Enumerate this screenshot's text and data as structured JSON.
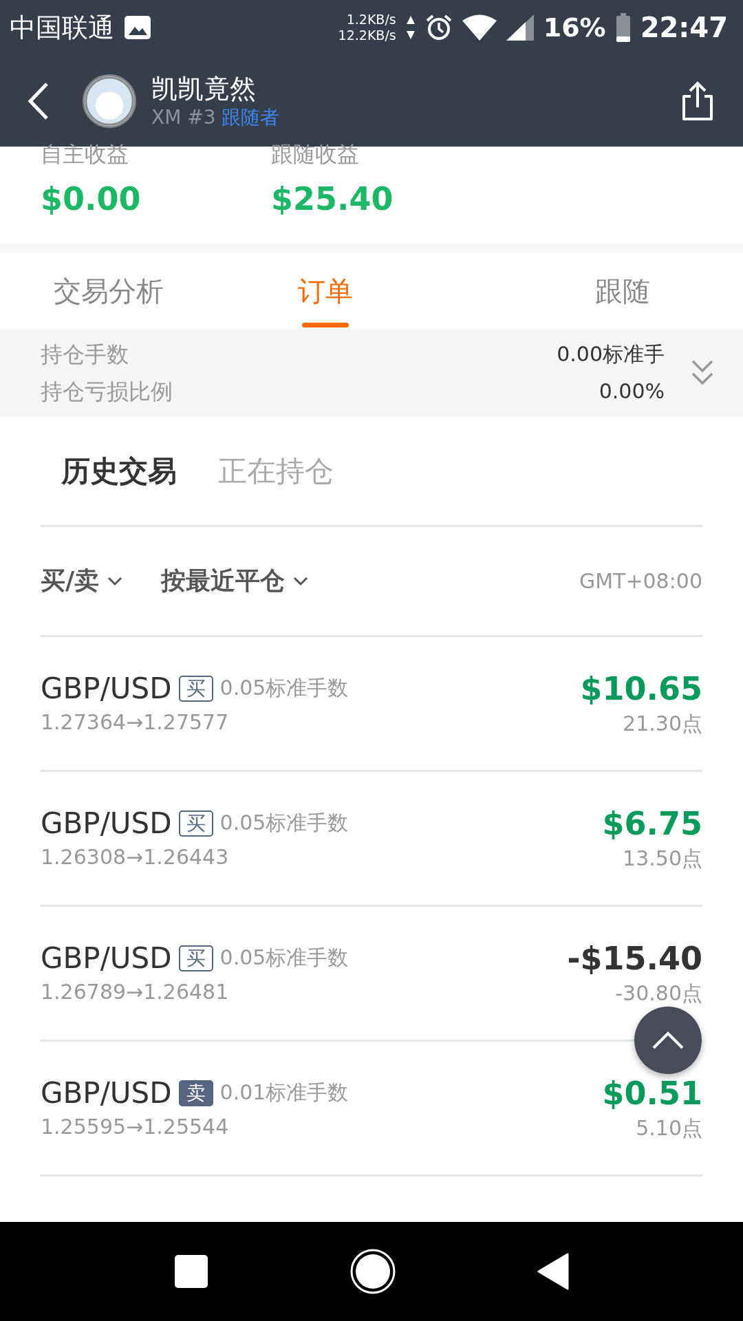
{
  "status_bar": {
    "carrier": "中国联通",
    "net_up": "1.2KB/s",
    "net_down": "12.2KB/s",
    "battery": "16%",
    "time": "22:47"
  },
  "header": {
    "name": "凯凯竟然",
    "account": "XM #3",
    "role": "跟随者"
  },
  "summary": [
    {
      "label": "自主收益",
      "value": "$0.00"
    },
    {
      "label": "跟随收益",
      "value": "$25.40"
    }
  ],
  "tabs": [
    {
      "label": "交易分析",
      "selected": false
    },
    {
      "label": "订单",
      "selected": true
    },
    {
      "label": "跟随",
      "selected": false
    }
  ],
  "stats": [
    {
      "label": "持仓手数",
      "value": "0.00标准手"
    },
    {
      "label": "持仓亏损比例",
      "value": "0.00%"
    }
  ],
  "sub_tabs": [
    {
      "label": "历史交易",
      "selected": true
    },
    {
      "label": "正在持仓",
      "selected": false
    }
  ],
  "filters": [
    {
      "label": "买/卖"
    },
    {
      "label": "按最近平仓"
    }
  ],
  "timezone": "GMT+08:00",
  "trades": [
    {
      "symbol": "GBP/USD",
      "kind": "buy",
      "side": "买",
      "lots": "0.05标准手数",
      "prices": "1.27364→1.27577",
      "profit": "$10.65",
      "color": "#0a9a5c",
      "points": "21.30点"
    },
    {
      "symbol": "GBP/USD",
      "kind": "buy",
      "side": "买",
      "lots": "0.05标准手数",
      "prices": "1.26308→1.26443",
      "profit": "$6.75",
      "color": "#0a9a5c",
      "points": "13.50点"
    },
    {
      "symbol": "GBP/USD",
      "kind": "buy",
      "side": "买",
      "lots": "0.05标准手数",
      "prices": "1.26789→1.26481",
      "profit": "-$15.40",
      "color": "#333333",
      "points": "-30.80点"
    },
    {
      "symbol": "GBP/USD",
      "kind": "sell",
      "side": "卖",
      "lots": "0.01标准手数",
      "prices": "1.25595→1.25544",
      "profit": "$0.51",
      "color": "#0a9a5c",
      "points": "5.10点"
    }
  ]
}
